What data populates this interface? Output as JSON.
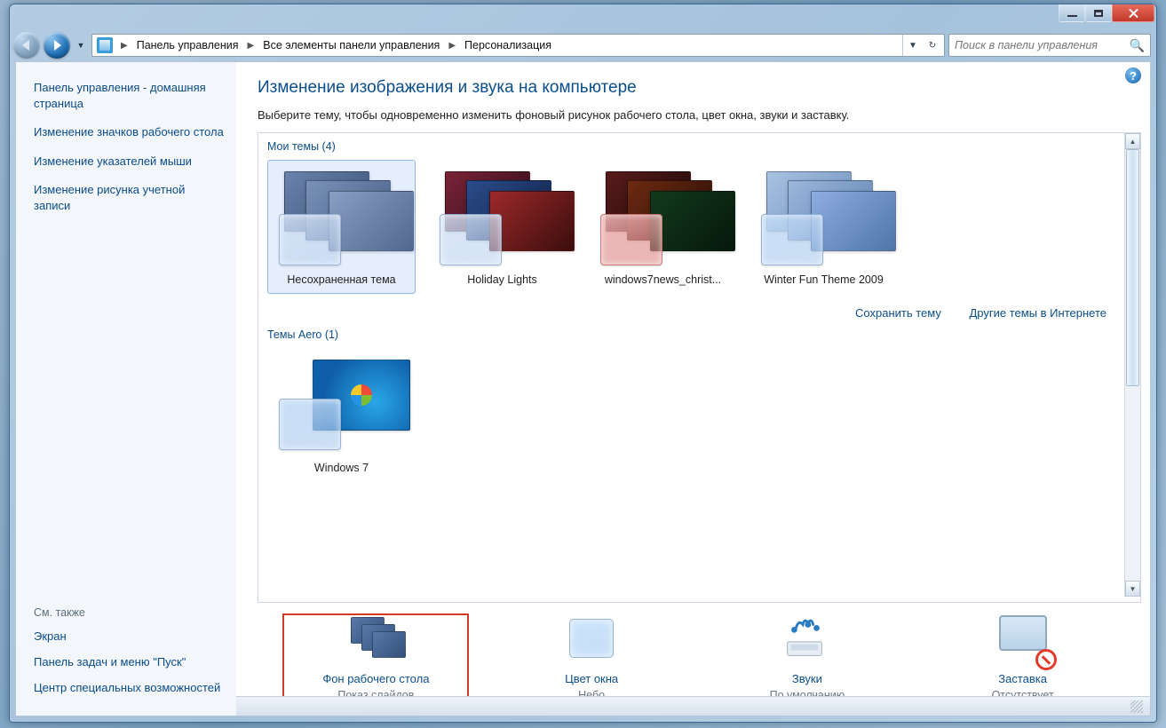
{
  "titlebar": {
    "minimize_tip": "Свернуть",
    "maximize_tip": "Развернуть",
    "close_tip": "Закрыть"
  },
  "breadcrumb": {
    "parts": [
      "Панель управления",
      "Все элементы панели управления",
      "Персонализация"
    ]
  },
  "search": {
    "placeholder": "Поиск в панели управления"
  },
  "sidebar": {
    "home": "Панель управления - домашняя страница",
    "links": [
      "Изменение значков рабочего стола",
      "Изменение указателей мыши",
      "Изменение рисунка учетной записи"
    ],
    "see_also_label": "См. также",
    "see_also": [
      "Экран",
      "Панель задач и меню \"Пуск\"",
      "Центр специальных возможностей"
    ]
  },
  "main": {
    "title": "Изменение изображения и звука на компьютере",
    "subtitle": "Выберите тему, чтобы одновременно изменить фоновый рисунок рабочего стола, цвет окна, звуки и заставку.",
    "sections": {
      "my_themes": {
        "label": "Мои темы (4)",
        "items": [
          {
            "name": "Несохраненная тема",
            "tint": "blue",
            "glass": "blue"
          },
          {
            "name": "Holiday Lights",
            "tint": "xmas",
            "glass": "blue"
          },
          {
            "name": "windows7news_christ...",
            "tint": "xmas2",
            "glass": "red"
          },
          {
            "name": "Winter Fun Theme 2009",
            "tint": "winter",
            "glass": "blue"
          }
        ]
      },
      "aero": {
        "label": "Темы Aero (1)",
        "items": [
          {
            "name": "Windows 7"
          }
        ]
      }
    },
    "theme_links": {
      "save": "Сохранить тему",
      "online": "Другие темы в Интернете"
    },
    "bottom": {
      "wallpaper": {
        "title": "Фон рабочего стола",
        "sub": "Показ слайдов"
      },
      "color": {
        "title": "Цвет окна",
        "sub": "Небо"
      },
      "sounds": {
        "title": "Звуки",
        "sub": "По умолчанию"
      },
      "saver": {
        "title": "Заставка",
        "sub": "Отсутствует"
      }
    }
  }
}
